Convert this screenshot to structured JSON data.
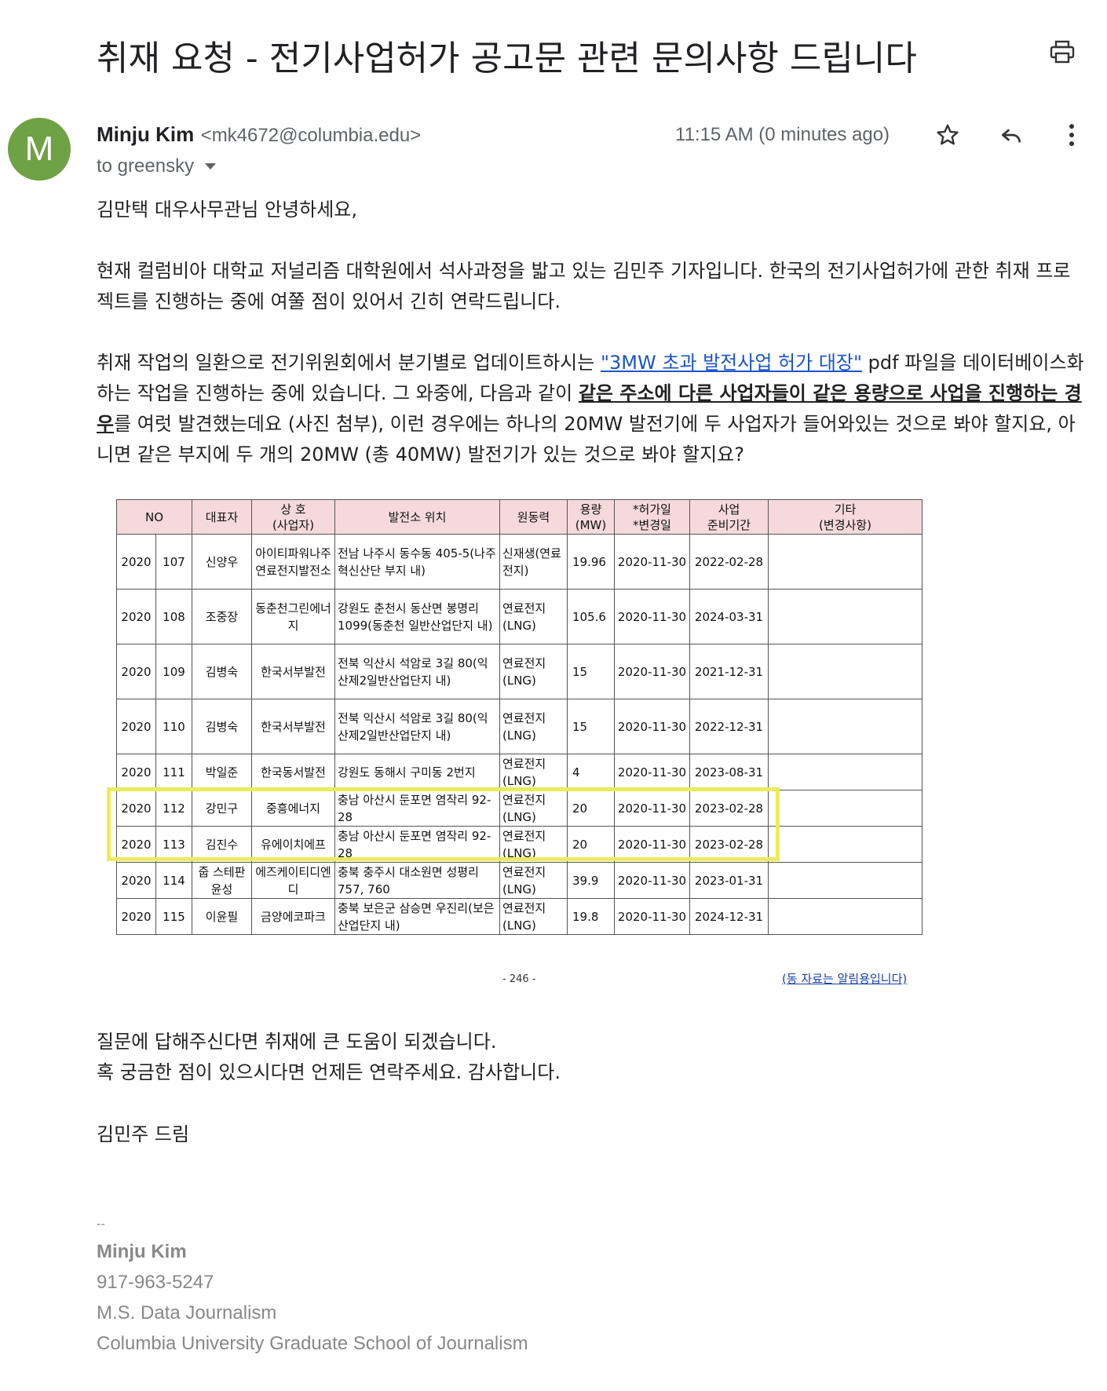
{
  "email": {
    "subject": "취재 요청 - 전기사업허가 공고문 관련 문의사항 드립니다",
    "avatar_letter": "M",
    "avatar_color": "#6fa145",
    "sender_name": "Minju Kim",
    "sender_email": "<mk4672@columbia.edu>",
    "to": "to greensky",
    "timestamp": "11:15 AM (0 minutes ago)"
  },
  "body": {
    "greeting": "김만택 대우사무관님 안녕하세요,",
    "para1": "현재 컬럼비아 대학교 저널리즘 대학원에서 석사과정을 밟고 있는 김민주 기자입니다. 한국의 전기사업허가에 관한 취재 프로젝트를 진행하는 중에 여쭐 점이 있어서 긴히 연락드립니다.",
    "para2_a": "취재 작업의 일환으로 전기위원회에서 분기별로 업데이트하시는 ",
    "para2_link": "\"3MW 초과 발전사업 허가 대장\"",
    "para2_b": " pdf 파일을 데이터베이스화하는 작업을 진행하는 중에 있습니다. 그 와중에, 다음과 같이 ",
    "para2_bold": "같은 주소에 다른 사업자들이 같은 용량으로 사업을 진행하는 경우",
    "para2_c": "를 여럿 발견했는데요 (사진 첨부), 이런 경우에는 하나의 20MW 발전기에 두 사업자가 들어와있는 것으로 봐야 할지요, 아니면 같은 부지에 두 개의 20MW (총 40MW) 발전기가 있는 것으로 봐야 할지요?",
    "closing1": "질문에 답해주신다면 취재에 큰 도움이 되겠습니다.",
    "closing2": "혹 궁금한 점이 있으시다면 언제든 연락주세요. 감사합니다.",
    "signoff": "김민주 드림"
  },
  "attachment": {
    "headers": {
      "no": "NO",
      "rep": "대표자",
      "company": "상 호\n(사업자)",
      "location": "발전소 위치",
      "fuel": "원동력",
      "capacity": "용량\n(MW)",
      "dates": "*허가일\n*변경일",
      "prep": "사업\n준비기간",
      "notes": "기타\n(변경사항)"
    },
    "rows": [
      {
        "year": "2020",
        "no": "107",
        "rep": "신양우",
        "company": "아이티파워나주연료전지발전소",
        "location": "전남 나주시 동수동 405-5(나주혁신산단 부지 내)",
        "fuel": "신재생(연료전지)",
        "capacity": "19.96",
        "date": "2020-11-30",
        "prep": "2022-02-28",
        "notes": ""
      },
      {
        "year": "2020",
        "no": "108",
        "rep": "조중장",
        "company": "동춘천그린에너지",
        "location": "강원도 춘천시 동산면 봉명리 1099(동춘천 일반산업단지 내)",
        "fuel": "연료전지(LNG)",
        "capacity": "105.6",
        "date": "2020-11-30",
        "prep": "2024-03-31",
        "notes": ""
      },
      {
        "year": "2020",
        "no": "109",
        "rep": "김병숙",
        "company": "한국서부발전",
        "location": "전북 익산시 석암로 3길 80(익산제2일반산업단지 내)",
        "fuel": "연료전지(LNG)",
        "capacity": "15",
        "date": "2020-11-30",
        "prep": "2021-12-31",
        "notes": ""
      },
      {
        "year": "2020",
        "no": "110",
        "rep": "김병숙",
        "company": "한국서부발전",
        "location": "전북 익산시 석암로 3길 80(익산제2일반산업단지 내)",
        "fuel": "연료전지(LNG)",
        "capacity": "15",
        "date": "2020-11-30",
        "prep": "2022-12-31",
        "notes": ""
      },
      {
        "year": "2020",
        "no": "111",
        "rep": "박일준",
        "company": "한국동서발전",
        "location": "강원도 동해시 구미동 2번지",
        "fuel": "연료전지(LNG)",
        "capacity": "4",
        "date": "2020-11-30",
        "prep": "2023-08-31",
        "notes": ""
      },
      {
        "year": "2020",
        "no": "112",
        "rep": "강민구",
        "company": "중흥에너지",
        "location": "충남 아산시 둔포면 염작리 92-28",
        "fuel": "연료전지(LNG)",
        "capacity": "20",
        "date": "2020-11-30",
        "prep": "2023-02-28",
        "notes": ""
      },
      {
        "year": "2020",
        "no": "113",
        "rep": "김진수",
        "company": "유에이치에프",
        "location": "충남 아산시 둔포면 염작리 92-28",
        "fuel": "연료전지(LNG)",
        "capacity": "20",
        "date": "2020-11-30",
        "prep": "2023-02-28",
        "notes": ""
      },
      {
        "year": "2020",
        "no": "114",
        "rep": "줍 스테판 윤성",
        "company": "에즈케이티디엔디",
        "location": "충북 충주시 대소원면 성평리 757, 760",
        "fuel": "연료전지(LNG)",
        "capacity": "39.9",
        "date": "2020-11-30",
        "prep": "2023-01-31",
        "notes": ""
      },
      {
        "year": "2020",
        "no": "115",
        "rep": "이윤필",
        "company": "금양에코파크",
        "location": "충북 보은군 삼승면 우진리(보은산업단지 내)",
        "fuel": "연료전지(LNG)",
        "capacity": "19.8",
        "date": "2020-11-30",
        "prep": "2024-12-31",
        "notes": ""
      }
    ],
    "page_number": "- 246 -",
    "footer_note": "(동 자료는 알림용입니다)",
    "highlight_color": "#ecec5a",
    "header_bg": "#f5d9dd"
  },
  "signature": {
    "dashes": "--",
    "name": "Minju Kim",
    "phone": "917-963-5247",
    "degree": "M.S. Data Journalism",
    "school": "Columbia University Graduate School of Journalism"
  },
  "icons": {
    "print": "print-icon",
    "star": "star-icon",
    "reply": "reply-icon",
    "more": "more-vert-icon",
    "dropdown": "caret-down-icon"
  }
}
